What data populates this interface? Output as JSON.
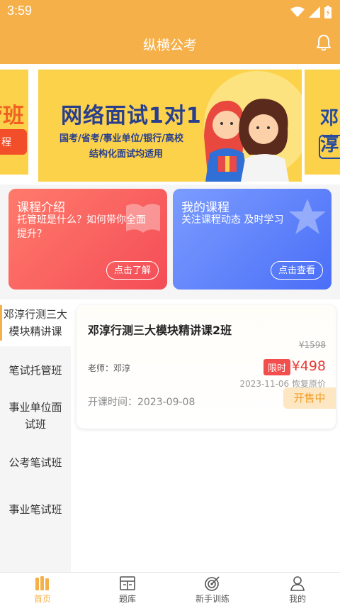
{
  "status_bar": {
    "time": "3:59",
    "icons": [
      "wifi-icon",
      "signal-icon",
      "battery-icon"
    ]
  },
  "header": {
    "title": "纵横公考",
    "bell_icon": "bell-icon"
  },
  "banner": {
    "headline": "网络面试1对1",
    "line1": "国考/省考/事业单位/银行/高校",
    "line2": "结构化面试均适用",
    "peek_left_text": "管班",
    "peek_left_button": "程",
    "peek_right_text": "邓淳"
  },
  "cards": [
    {
      "title": "课程介绍",
      "desc": "托管班是什么？如何带你全面提升？",
      "button": "点击了解",
      "color": "#f44d57"
    },
    {
      "title": "我的课程",
      "desc": "关注课程动态 及时学习",
      "button": "点击查看",
      "color": "#4a6ef7"
    }
  ],
  "sidebar": {
    "items": [
      {
        "label": "邓淳行测三大模块精讲课",
        "active": true
      },
      {
        "label": "笔试托管班",
        "active": false
      },
      {
        "label": "事业单位面试班",
        "active": false
      },
      {
        "label": "公考笔试班",
        "active": false
      },
      {
        "label": "事业笔试班",
        "active": false
      }
    ]
  },
  "course": {
    "title": "邓淳行测三大模块精讲课2班",
    "original_price": "¥1598",
    "teacher": "老师：邓淳",
    "limit_tag": "限时",
    "price": "¥498",
    "restore_note": "2023-11-06 恢复原价",
    "start_time": "开课时间：2023-09-08",
    "status": "开售中"
  },
  "tabbar": {
    "tabs": [
      {
        "label": "首页",
        "icon": "home-books-icon",
        "active": true
      },
      {
        "label": "题库",
        "icon": "question-bank-icon",
        "active": false
      },
      {
        "label": "新手训练",
        "icon": "target-icon",
        "active": false
      },
      {
        "label": "我的",
        "icon": "user-icon",
        "active": false
      }
    ]
  },
  "colors": {
    "accent": "#f6b04a",
    "red": "#f44d57",
    "blue": "#4a6ef7",
    "price": "#e53935"
  }
}
